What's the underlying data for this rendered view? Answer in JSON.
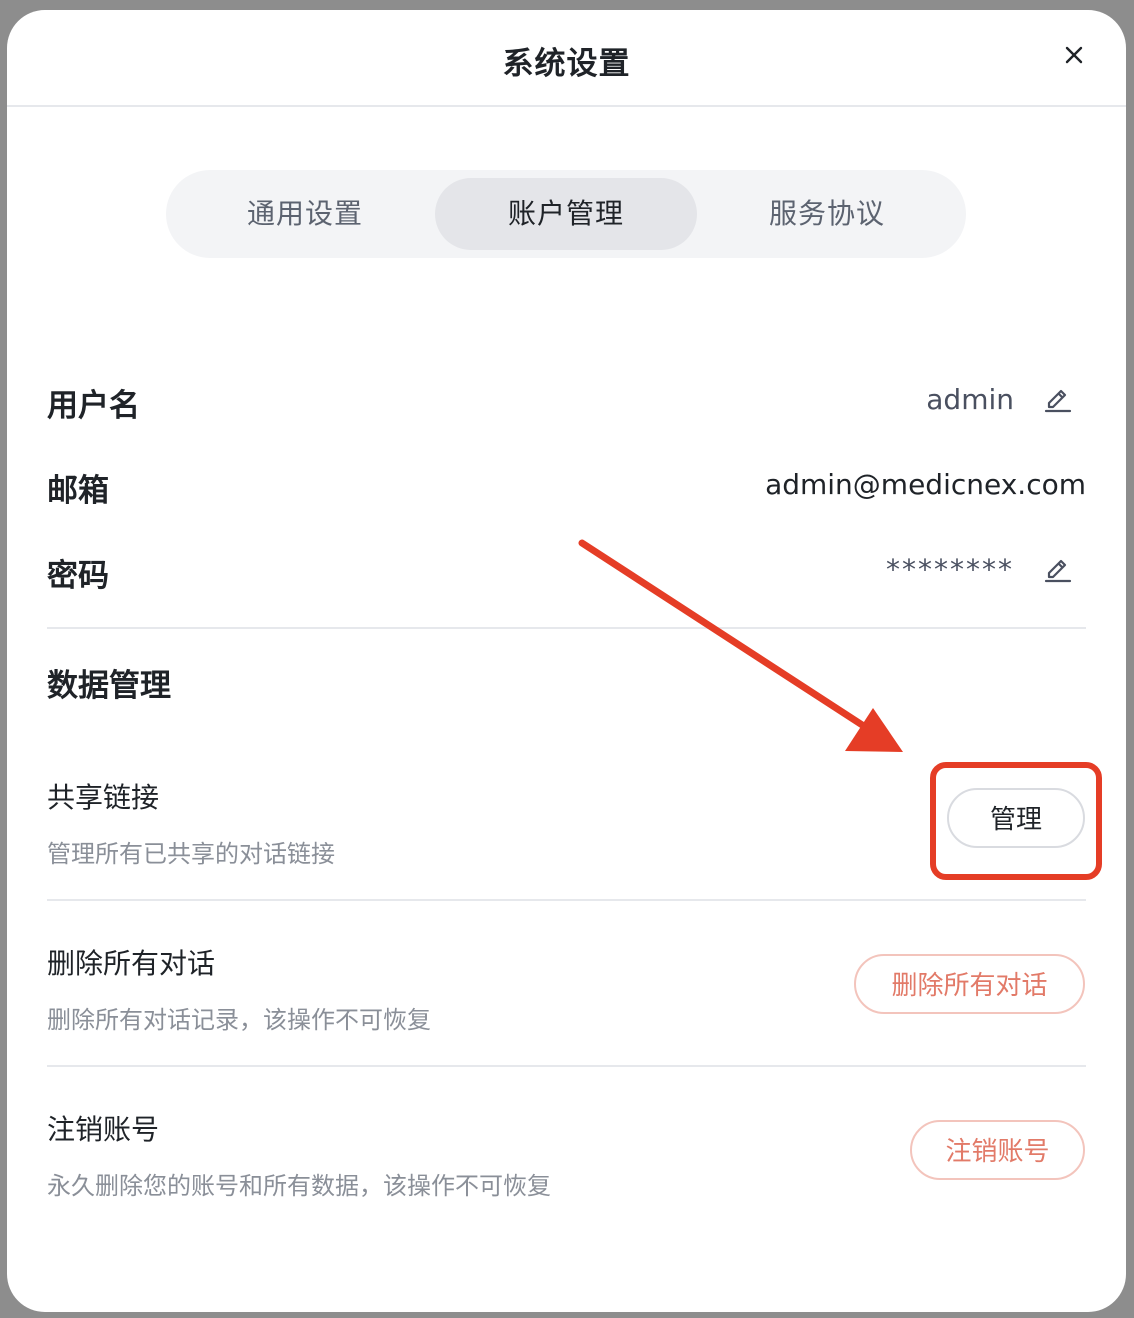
{
  "dialog": {
    "title": "系统设置"
  },
  "tabs": [
    {
      "label": "通用设置",
      "active": false
    },
    {
      "label": "账户管理",
      "active": true
    },
    {
      "label": "服务协议",
      "active": false
    }
  ],
  "account": {
    "username_label": "用户名",
    "username_value": "admin",
    "email_label": "邮箱",
    "email_value": "admin@medicnex.com",
    "password_label": "密码",
    "password_value": "********"
  },
  "data_management": {
    "title": "数据管理",
    "items": [
      {
        "title": "共享链接",
        "description": "管理所有已共享的对话链接",
        "button": "管理"
      },
      {
        "title": "删除所有对话",
        "description": "删除所有对话记录，该操作不可恢复",
        "button": "删除所有对话"
      },
      {
        "title": "注销账号",
        "description": "永久删除您的账号和所有数据，该操作不可恢复",
        "button": "注销账号"
      }
    ]
  },
  "colors": {
    "annotation": "#e53d26",
    "danger_text": "#e27a68",
    "danger_border": "#f3c4bc",
    "active_tab": "#e4e5e9",
    "tab_bar": "#f3f4f6"
  }
}
